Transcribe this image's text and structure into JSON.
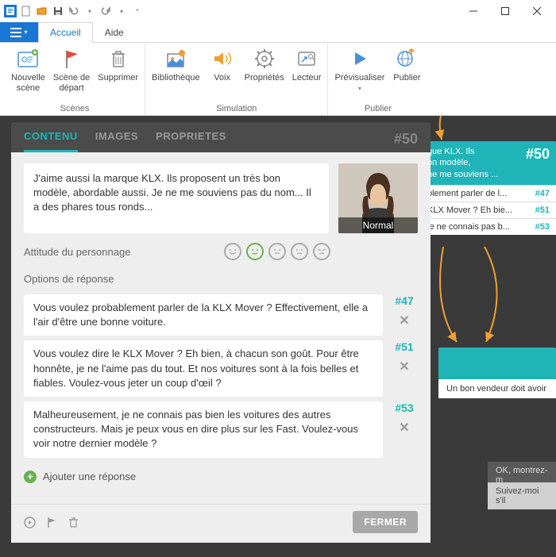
{
  "ribbon": {
    "tabs": {
      "accueil": "Accueil",
      "aide": "Aide"
    },
    "groups": {
      "scenes": "Scènes",
      "simulation": "Simulation",
      "publier": "Publier"
    },
    "buttons": {
      "nouvelle_scene": "Nouvelle\nscène",
      "scene_depart": "Scène de\ndépart",
      "supprimer": "Supprimer",
      "bibliotheque": "Bibliothèque",
      "voix": "Voix",
      "proprietes": "Propriétés",
      "lecteur": "Lecteur",
      "previsualiser": "Prévisualiser",
      "publier": "Publier"
    }
  },
  "panel": {
    "tabs": {
      "contenu": "CONTENU",
      "images": "IMAGES",
      "proprietes": "PROPRIETES"
    },
    "scene_id": "#50",
    "speech": "J'aime aussi la marque KLX. Ils proposent un très bon modèle, abordable aussi. Je ne me souviens pas du nom... Il a des phares tous ronds...",
    "avatar_label": "Normal",
    "attitude_label": "Attitude du personnage",
    "section_label": "Options de réponse",
    "responses": [
      {
        "id": "#47",
        "text": "Vous voulez probablement parler de la KLX Mover ? Effectivement, elle a l'air d'être une bonne voiture."
      },
      {
        "id": "#51",
        "text": "Vous voulez dire le KLX Mover ? Eh bien, à chacun son goût. Pour être honnête, je ne l'aime pas du tout. Et nos voitures sont à la fois belles et fiables. Voulez-vous jeter un coup d'œil ?"
      },
      {
        "id": "#53",
        "text": "Malheureusement, je ne connais pas bien les voitures des autres constructeurs. Mais je peux vous en dire plus sur les Fast. Voulez-vous voir notre dernier modèle ?"
      }
    ],
    "add_label": "Ajouter une réponse",
    "close_label": "FERMER"
  },
  "canvas": {
    "node50": {
      "id": "#50",
      "line1": "que KLX. Ils",
      "line2": "on modèle,",
      "line3": "ne me souviens ...",
      "rows": [
        {
          "text": "blement parler de l...",
          "id": "#47"
        },
        {
          "text": "KLX Mover ? Eh bie...",
          "id": "#51"
        },
        {
          "text": "je ne connais pas b...",
          "id": "#53"
        }
      ]
    },
    "caption": "Un bon vendeur doit avoir",
    "grey1": "OK, montrez-m",
    "grey2": "Suivez-moi s'il"
  }
}
